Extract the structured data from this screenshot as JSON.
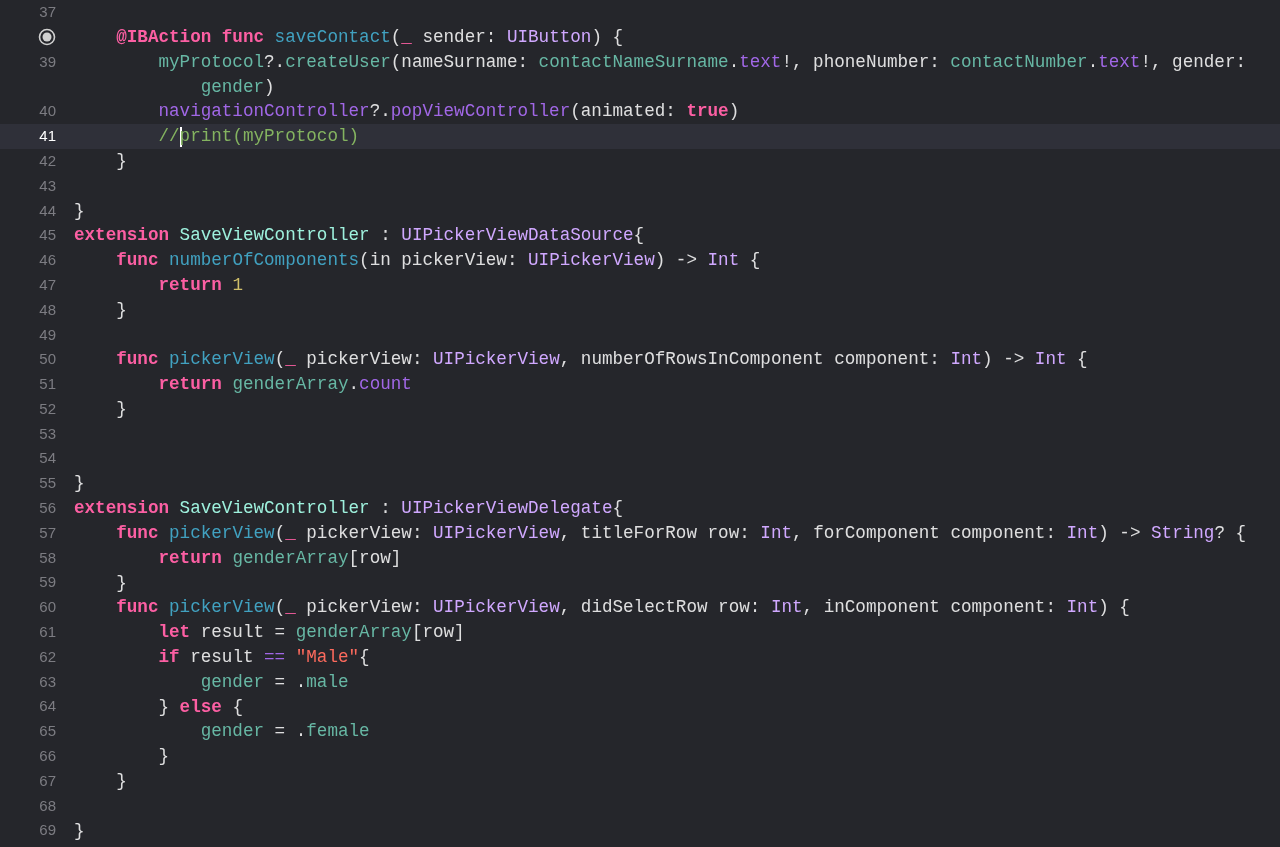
{
  "editor": {
    "lines": [
      {
        "number": "37",
        "breakpoint": false,
        "current": false,
        "caret": false
      },
      {
        "breakpoint": true,
        "current": false,
        "caret": false,
        "tokens": [
          {
            "text": "    @IBAction ",
            "kind": "keyword"
          },
          {
            "text": "func ",
            "kind": "keyword"
          },
          {
            "text": "saveContact",
            "kind": "decl"
          },
          {
            "text": "(",
            "kind": "plain"
          },
          {
            "text": "_",
            "kind": "keyword"
          },
          {
            "text": " sender: ",
            "kind": "plain"
          },
          {
            "text": "UIButton",
            "kind": "type"
          },
          {
            "text": ") {",
            "kind": "plain"
          }
        ]
      },
      {
        "number": "39",
        "breakpoint": false,
        "current": false,
        "caret": false,
        "tokens": [
          {
            "text": "        myProtocol",
            "kind": "project"
          },
          {
            "text": "?.",
            "kind": "plain"
          },
          {
            "text": "createUser",
            "kind": "project"
          },
          {
            "text": "(nameSurname: ",
            "kind": "plain"
          },
          {
            "text": "contactNameSurname",
            "kind": "project"
          },
          {
            "text": ".",
            "kind": "plain"
          },
          {
            "text": "text",
            "kind": "member"
          },
          {
            "text": "!, phoneNumber: ",
            "kind": "plain"
          },
          {
            "text": "contactNumber",
            "kind": "project"
          },
          {
            "text": ".",
            "kind": "plain"
          },
          {
            "text": "text",
            "kind": "member"
          },
          {
            "text": "!, gender:",
            "kind": "plain"
          }
        ],
        "wrapped_tokens": [
          {
            "text": "            gender",
            "kind": "project"
          },
          {
            "text": ")",
            "kind": "plain"
          }
        ]
      },
      {
        "number": "40",
        "breakpoint": false,
        "current": false,
        "caret": false,
        "tokens": [
          {
            "text": "        navigationController",
            "kind": "member"
          },
          {
            "text": "?.",
            "kind": "plain"
          },
          {
            "text": "popViewController",
            "kind": "member"
          },
          {
            "text": "(animated: ",
            "kind": "plain"
          },
          {
            "text": "true",
            "kind": "keyword"
          },
          {
            "text": ")",
            "kind": "plain"
          }
        ]
      },
      {
        "number": "41",
        "breakpoint": false,
        "current": true,
        "caret": true,
        "tokens": [
          {
            "text": "        //",
            "kind": "comment"
          },
          {
            "text": "print(myProtocol)",
            "kind": "comment"
          }
        ]
      },
      {
        "number": "42",
        "breakpoint": false,
        "current": false,
        "caret": false,
        "tokens": [
          {
            "text": "    }",
            "kind": "plain"
          }
        ]
      },
      {
        "number": "43",
        "breakpoint": false,
        "current": false,
        "caret": false
      },
      {
        "number": "44",
        "breakpoint": false,
        "current": false,
        "caret": false,
        "tokens": [
          {
            "text": "}",
            "kind": "plain"
          }
        ]
      },
      {
        "number": "45",
        "breakpoint": false,
        "current": false,
        "caret": false,
        "tokens": [
          {
            "text": "extension ",
            "kind": "keyword"
          },
          {
            "text": "SaveViewController",
            "kind": "project_type"
          },
          {
            "text": " : ",
            "kind": "plain"
          },
          {
            "text": "UIPickerViewDataSource",
            "kind": "type"
          },
          {
            "text": "{",
            "kind": "plain"
          }
        ]
      },
      {
        "number": "46",
        "breakpoint": false,
        "current": false,
        "caret": false,
        "tokens": [
          {
            "text": "    func ",
            "kind": "keyword"
          },
          {
            "text": "numberOfComponents",
            "kind": "decl"
          },
          {
            "text": "(in pickerView: ",
            "kind": "plain"
          },
          {
            "text": "UIPickerView",
            "kind": "type"
          },
          {
            "text": ") -> ",
            "kind": "plain"
          },
          {
            "text": "Int",
            "kind": "type"
          },
          {
            "text": " {",
            "kind": "plain"
          }
        ]
      },
      {
        "number": "47",
        "breakpoint": false,
        "current": false,
        "caret": false,
        "tokens": [
          {
            "text": "        return ",
            "kind": "keyword"
          },
          {
            "text": "1",
            "kind": "number"
          }
        ]
      },
      {
        "number": "48",
        "breakpoint": false,
        "current": false,
        "caret": false,
        "tokens": [
          {
            "text": "    }",
            "kind": "plain"
          }
        ]
      },
      {
        "number": "49",
        "breakpoint": false,
        "current": false,
        "caret": false
      },
      {
        "number": "50",
        "breakpoint": false,
        "current": false,
        "caret": false,
        "tokens": [
          {
            "text": "    func ",
            "kind": "keyword"
          },
          {
            "text": "pickerView",
            "kind": "decl"
          },
          {
            "text": "(",
            "kind": "plain"
          },
          {
            "text": "_",
            "kind": "keyword"
          },
          {
            "text": " pickerView: ",
            "kind": "plain"
          },
          {
            "text": "UIPickerView",
            "kind": "type"
          },
          {
            "text": ", numberOfRowsInComponent component: ",
            "kind": "plain"
          },
          {
            "text": "Int",
            "kind": "type"
          },
          {
            "text": ") -> ",
            "kind": "plain"
          },
          {
            "text": "Int",
            "kind": "type"
          },
          {
            "text": " {",
            "kind": "plain"
          }
        ]
      },
      {
        "number": "51",
        "breakpoint": false,
        "current": false,
        "caret": false,
        "tokens": [
          {
            "text": "        return ",
            "kind": "keyword"
          },
          {
            "text": "genderArray",
            "kind": "project"
          },
          {
            "text": ".",
            "kind": "plain"
          },
          {
            "text": "count",
            "kind": "member"
          }
        ]
      },
      {
        "number": "52",
        "breakpoint": false,
        "current": false,
        "caret": false,
        "tokens": [
          {
            "text": "    }",
            "kind": "plain"
          }
        ]
      },
      {
        "number": "53",
        "breakpoint": false,
        "current": false,
        "caret": false
      },
      {
        "number": "54",
        "breakpoint": false,
        "current": false,
        "caret": false
      },
      {
        "number": "55",
        "breakpoint": false,
        "current": false,
        "caret": false,
        "tokens": [
          {
            "text": "}",
            "kind": "plain"
          }
        ]
      },
      {
        "number": "56",
        "breakpoint": false,
        "current": false,
        "caret": false,
        "tokens": [
          {
            "text": "extension ",
            "kind": "keyword"
          },
          {
            "text": "SaveViewController",
            "kind": "project_type"
          },
          {
            "text": " : ",
            "kind": "plain"
          },
          {
            "text": "UIPickerViewDelegate",
            "kind": "type"
          },
          {
            "text": "{",
            "kind": "plain"
          }
        ]
      },
      {
        "number": "57",
        "breakpoint": false,
        "current": false,
        "caret": false,
        "tokens": [
          {
            "text": "    func ",
            "kind": "keyword"
          },
          {
            "text": "pickerView",
            "kind": "decl"
          },
          {
            "text": "(",
            "kind": "plain"
          },
          {
            "text": "_",
            "kind": "keyword"
          },
          {
            "text": " pickerView: ",
            "kind": "plain"
          },
          {
            "text": "UIPickerView",
            "kind": "type"
          },
          {
            "text": ", titleForRow row: ",
            "kind": "plain"
          },
          {
            "text": "Int",
            "kind": "type"
          },
          {
            "text": ", forComponent component: ",
            "kind": "plain"
          },
          {
            "text": "Int",
            "kind": "type"
          },
          {
            "text": ") -> ",
            "kind": "plain"
          },
          {
            "text": "String",
            "kind": "type"
          },
          {
            "text": "? {",
            "kind": "plain"
          }
        ]
      },
      {
        "number": "58",
        "breakpoint": false,
        "current": false,
        "caret": false,
        "tokens": [
          {
            "text": "        return ",
            "kind": "keyword"
          },
          {
            "text": "genderArray",
            "kind": "project"
          },
          {
            "text": "[row]",
            "kind": "plain"
          }
        ]
      },
      {
        "number": "59",
        "breakpoint": false,
        "current": false,
        "caret": false,
        "tokens": [
          {
            "text": "    }",
            "kind": "plain"
          }
        ]
      },
      {
        "number": "60",
        "breakpoint": false,
        "current": false,
        "caret": false,
        "tokens": [
          {
            "text": "    func ",
            "kind": "keyword"
          },
          {
            "text": "pickerView",
            "kind": "decl"
          },
          {
            "text": "(",
            "kind": "plain"
          },
          {
            "text": "_",
            "kind": "keyword"
          },
          {
            "text": " pickerView: ",
            "kind": "plain"
          },
          {
            "text": "UIPickerView",
            "kind": "type"
          },
          {
            "text": ", didSelectRow row: ",
            "kind": "plain"
          },
          {
            "text": "Int",
            "kind": "type"
          },
          {
            "text": ", inComponent component: ",
            "kind": "plain"
          },
          {
            "text": "Int",
            "kind": "type"
          },
          {
            "text": ") {",
            "kind": "plain"
          }
        ]
      },
      {
        "number": "61",
        "breakpoint": false,
        "current": false,
        "caret": false,
        "tokens": [
          {
            "text": "        let",
            "kind": "keyword"
          },
          {
            "text": " result = ",
            "kind": "plain"
          },
          {
            "text": "genderArray",
            "kind": "project"
          },
          {
            "text": "[row]",
            "kind": "plain"
          }
        ]
      },
      {
        "number": "62",
        "breakpoint": false,
        "current": false,
        "caret": false,
        "tokens": [
          {
            "text": "        if",
            "kind": "keyword"
          },
          {
            "text": " result ",
            "kind": "plain"
          },
          {
            "text": "==",
            "kind": "member"
          },
          {
            "text": " \"Male\"",
            "kind": "string"
          },
          {
            "text": "{",
            "kind": "plain"
          }
        ]
      },
      {
        "number": "63",
        "breakpoint": false,
        "current": false,
        "caret": false,
        "tokens": [
          {
            "text": "            gender",
            "kind": "project"
          },
          {
            "text": " = .",
            "kind": "plain"
          },
          {
            "text": "male",
            "kind": "project"
          }
        ]
      },
      {
        "number": "64",
        "breakpoint": false,
        "current": false,
        "caret": false,
        "tokens": [
          {
            "text": "        } ",
            "kind": "plain"
          },
          {
            "text": "else",
            "kind": "keyword"
          },
          {
            "text": " {",
            "kind": "plain"
          }
        ]
      },
      {
        "number": "65",
        "breakpoint": false,
        "current": false,
        "caret": false,
        "tokens": [
          {
            "text": "            gender",
            "kind": "project"
          },
          {
            "text": " = .",
            "kind": "plain"
          },
          {
            "text": "female",
            "kind": "project"
          }
        ]
      },
      {
        "number": "66",
        "breakpoint": false,
        "current": false,
        "caret": false,
        "tokens": [
          {
            "text": "        }",
            "kind": "plain"
          }
        ]
      },
      {
        "number": "67",
        "breakpoint": false,
        "current": false,
        "caret": false,
        "tokens": [
          {
            "text": "    }",
            "kind": "plain"
          }
        ]
      },
      {
        "number": "68",
        "breakpoint": false,
        "current": false,
        "caret": false
      },
      {
        "number": "69",
        "breakpoint": false,
        "current": false,
        "caret": false,
        "tokens": [
          {
            "text": "}",
            "kind": "plain"
          }
        ]
      }
    ]
  }
}
